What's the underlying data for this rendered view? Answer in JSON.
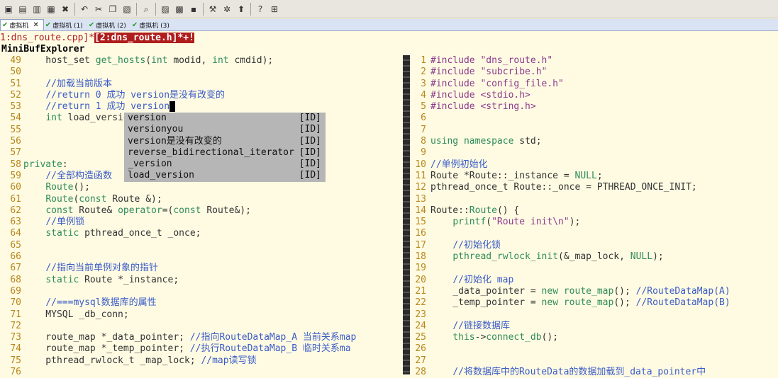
{
  "toolbar": {
    "buttons": [
      {
        "icon": "open-icon",
        "glyph": "▣"
      },
      {
        "icon": "save-icon",
        "glyph": "▤"
      },
      {
        "icon": "save-all-icon",
        "glyph": "▥"
      },
      {
        "icon": "print-icon",
        "glyph": "▦"
      },
      {
        "icon": "close-icon",
        "glyph": "✖"
      },
      {
        "icon": "undo-icon",
        "glyph": "↶"
      },
      {
        "icon": "cut-icon",
        "glyph": "✂"
      },
      {
        "icon": "copy-icon",
        "glyph": "❐"
      },
      {
        "icon": "paste-icon",
        "glyph": "▧"
      },
      {
        "icon": "find-icon",
        "glyph": "⌕"
      },
      {
        "icon": "load-session-icon",
        "glyph": "▨"
      },
      {
        "icon": "save-session-icon",
        "glyph": "▩"
      },
      {
        "icon": "run-script-icon",
        "glyph": "▪"
      },
      {
        "icon": "make-icon",
        "glyph": "⚒"
      },
      {
        "icon": "ctags-icon",
        "glyph": "✲"
      },
      {
        "icon": "jump-tag-icon",
        "glyph": "⬆"
      },
      {
        "icon": "help-icon",
        "glyph": "?"
      },
      {
        "icon": "find-help-icon",
        "glyph": "⊞"
      }
    ]
  },
  "vm_tabs": [
    {
      "label": "虚拟机",
      "active": true
    },
    {
      "label": "虚拟机 (1)",
      "active": false
    },
    {
      "label": "虚拟机 (2)",
      "active": false
    },
    {
      "label": "虚拟机 (3)",
      "active": false
    }
  ],
  "buffers": {
    "inactive": "1:dns_route.cpp]*",
    "active": "[2:dns_route.h]*+!"
  },
  "minibuf_title": "MiniBufExplorer",
  "left_lines": [
    {
      "n": "49",
      "t": "    host_set get_hosts(int modid, int cmdid);"
    },
    {
      "n": "50",
      "t": ""
    },
    {
      "n": "51",
      "t": "    //加载当前版本"
    },
    {
      "n": "52",
      "t": "    //return 0 成功 version是没有改变的"
    },
    {
      "n": "53",
      "t": "    //return 1 成功 version"
    },
    {
      "n": "54",
      "t": "    int load_versio"
    },
    {
      "n": "55",
      "t": ""
    },
    {
      "n": "56",
      "t": ""
    },
    {
      "n": "57",
      "t": ""
    },
    {
      "n": "58",
      "t": "private:"
    },
    {
      "n": "59",
      "t": "    //全部构造函数"
    },
    {
      "n": "60",
      "t": "    Route();"
    },
    {
      "n": "61",
      "t": "    Route(const Route &);"
    },
    {
      "n": "62",
      "t": "    const Route& operator=(const Route&);"
    },
    {
      "n": "63",
      "t": "    //单例锁"
    },
    {
      "n": "64",
      "t": "    static pthread_once_t _once;"
    },
    {
      "n": "65",
      "t": ""
    },
    {
      "n": "66",
      "t": ""
    },
    {
      "n": "67",
      "t": "    //指向当前单例对象的指针"
    },
    {
      "n": "68",
      "t": "    static Route *_instance;"
    },
    {
      "n": "69",
      "t": ""
    },
    {
      "n": "70",
      "t": "    //===mysql数据库的属性"
    },
    {
      "n": "71",
      "t": "    MYSQL _db_conn;"
    },
    {
      "n": "72",
      "t": ""
    },
    {
      "n": "73",
      "t": "    route_map *_data_pointer; //指向RouteDataMap_A 当前关系map"
    },
    {
      "n": "74",
      "t": "    route_map *_temp_pointer; //执行RouteDataMap_B 临时关系ma"
    },
    {
      "n": "75",
      "t": "    pthread_rwlock_t _map_lock; //map读写锁"
    },
    {
      "n": "76",
      "t": ""
    }
  ],
  "right_lines": [
    {
      "n": "1",
      "t": "#include \"dns_route.h\""
    },
    {
      "n": "2",
      "t": "#include \"subcribe.h\""
    },
    {
      "n": "3",
      "t": "#include \"config_file.h\""
    },
    {
      "n": "4",
      "t": "#include <stdio.h>"
    },
    {
      "n": "5",
      "t": "#include <string.h>"
    },
    {
      "n": "6",
      "t": ""
    },
    {
      "n": "7",
      "t": ""
    },
    {
      "n": "8",
      "t": "using namespace std;"
    },
    {
      "n": "9",
      "t": ""
    },
    {
      "n": "10",
      "t": "//单例初始化"
    },
    {
      "n": "11",
      "t": "Route *Route::_instance = NULL;"
    },
    {
      "n": "12",
      "t": "pthread_once_t Route::_once = PTHREAD_ONCE_INIT;"
    },
    {
      "n": "13",
      "t": ""
    },
    {
      "n": "14",
      "t": "Route::Route() {"
    },
    {
      "n": "15",
      "t": "    printf(\"Route init\\n\");"
    },
    {
      "n": "16",
      "t": ""
    },
    {
      "n": "17",
      "t": "    //初始化锁"
    },
    {
      "n": "18",
      "t": "    pthread_rwlock_init(&_map_lock, NULL);"
    },
    {
      "n": "19",
      "t": ""
    },
    {
      "n": "20",
      "t": "    //初始化 map"
    },
    {
      "n": "21",
      "t": "    _data_pointer = new route_map(); //RouteDataMap(A)"
    },
    {
      "n": "22",
      "t": "    _temp_pointer = new route_map(); //RouteDataMap(B)"
    },
    {
      "n": "23",
      "t": ""
    },
    {
      "n": "24",
      "t": "    //链接数据库"
    },
    {
      "n": "25",
      "t": "    this->connect_db();"
    },
    {
      "n": "26",
      "t": ""
    },
    {
      "n": "27",
      "t": ""
    },
    {
      "n": "28",
      "t": "    //将数据库中的RouteData的数据加载到_data_pointer中"
    }
  ],
  "completion": {
    "items": [
      {
        "word": "version",
        "kind": "[ID]"
      },
      {
        "word": "versionyou",
        "kind": "[ID]"
      },
      {
        "word": "version是没有改变的",
        "kind": "[ID]"
      },
      {
        "word": "reverse_bidirectional_iterator",
        "kind": "[ID]"
      },
      {
        "word": "_version",
        "kind": "[ID]"
      },
      {
        "word": "load_version",
        "kind": "[ID]"
      }
    ]
  },
  "colors": {
    "background": "#fffbe3",
    "line_number": "#b8861b",
    "comment": "#3a5bc7",
    "keyword": "#2e8b57",
    "active_buffer": "#b01d1d",
    "popup": "#b6b6b6"
  }
}
